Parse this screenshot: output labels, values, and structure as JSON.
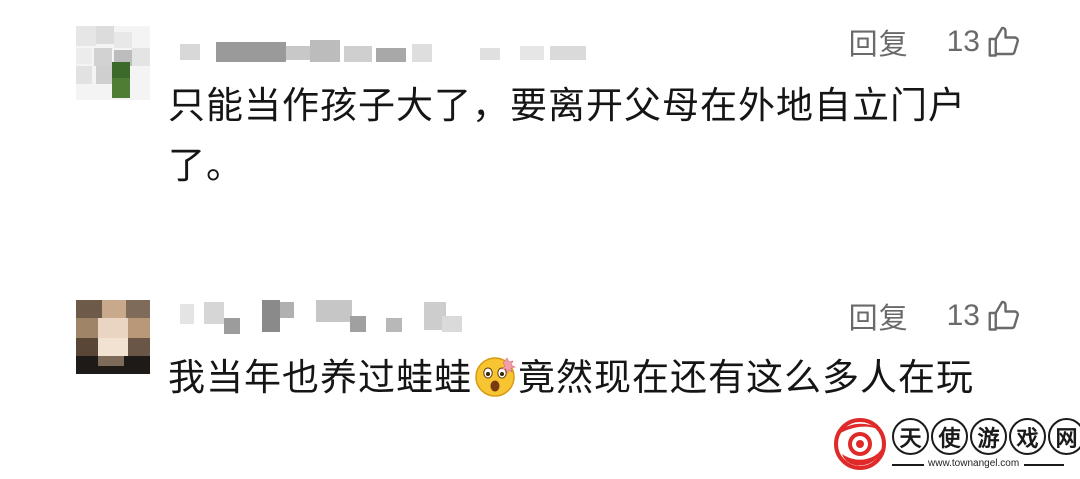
{
  "comments": [
    {
      "reply_label": "回复",
      "like_count": "13",
      "text": "只能当作孩子大了，要离开父母在外地自立门户了。"
    },
    {
      "reply_label": "回复",
      "like_count": "13",
      "text_before_emoji": "我当年也养过蛙蛙",
      "emoji": "astonished-face-emoji",
      "text_after_emoji": "竟然现在还有这么多人在玩"
    }
  ],
  "watermark": {
    "brand_chars": [
      "天",
      "使",
      "游",
      "戏",
      "网"
    ],
    "url": "www.townangel.com",
    "logo_color": "#e02a2a"
  },
  "icons": {
    "like": "thumbs-up-icon",
    "avatar": "blurred-avatar"
  }
}
